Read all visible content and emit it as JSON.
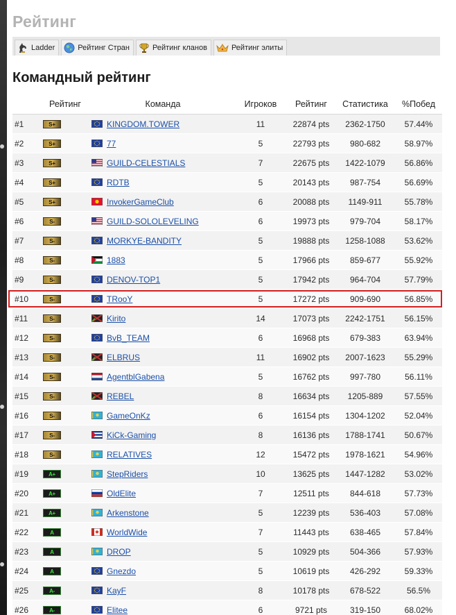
{
  "page": {
    "title": "Рейтинг"
  },
  "tabs": [
    {
      "label": "Ladder",
      "icon": "knight-icon"
    },
    {
      "label": "Рейтинг Стран",
      "icon": "globe-icon"
    },
    {
      "label": "Рейтинг кланов",
      "icon": "trophy-icon"
    },
    {
      "label": "Рейтинг элиты",
      "icon": "crown-icon"
    }
  ],
  "section": {
    "title": "Командный рейтинг"
  },
  "table": {
    "headers": {
      "rating": "Рейтинг",
      "team": "Команда",
      "players": "Игроков",
      "points": "Рейтинг",
      "stats": "Статистика",
      "winrate": "%Побед"
    },
    "highlight_rank": "#10",
    "rows": [
      {
        "rank": "#1",
        "tier": "S+",
        "flag": "eu",
        "team": "KINGDOM.TOWER",
        "players": "11",
        "points": "22874 pts",
        "stats": "2362-1750",
        "winrate": "57.44%"
      },
      {
        "rank": "#2",
        "tier": "S+",
        "flag": "eu",
        "team": "77",
        "players": "5",
        "points": "22793 pts",
        "stats": "980-682",
        "winrate": "58.97%"
      },
      {
        "rank": "#3",
        "tier": "S+",
        "flag": "us",
        "team": "GUILD-CELESTIALS",
        "players": "7",
        "points": "22675 pts",
        "stats": "1422-1079",
        "winrate": "56.86%"
      },
      {
        "rank": "#4",
        "tier": "S+",
        "flag": "eu",
        "team": "RDTB",
        "players": "5",
        "points": "20143 pts",
        "stats": "987-754",
        "winrate": "56.69%"
      },
      {
        "rank": "#5",
        "tier": "S+",
        "flag": "kg",
        "team": "InvokerGameClub",
        "players": "6",
        "points": "20088 pts",
        "stats": "1149-911",
        "winrate": "55.78%"
      },
      {
        "rank": "#6",
        "tier": "S-",
        "flag": "us",
        "team": "GUILD-SOLOLEVELING",
        "players": "6",
        "points": "19973 pts",
        "stats": "979-704",
        "winrate": "58.17%"
      },
      {
        "rank": "#7",
        "tier": "S-",
        "flag": "eu",
        "team": "MORKYE-BANDITY",
        "players": "5",
        "points": "19888 pts",
        "stats": "1258-1088",
        "winrate": "53.62%"
      },
      {
        "rank": "#8",
        "tier": "S-",
        "flag": "jo",
        "team": "1883",
        "players": "5",
        "points": "17966 pts",
        "stats": "859-677",
        "winrate": "55.92%"
      },
      {
        "rank": "#9",
        "tier": "S-",
        "flag": "eu",
        "team": "DENOV-TOP1",
        "players": "5",
        "points": "17942 pts",
        "stats": "964-704",
        "winrate": "57.79%"
      },
      {
        "rank": "#10",
        "tier": "S-",
        "flag": "eu",
        "team": "TRooY",
        "players": "5",
        "points": "17272 pts",
        "stats": "909-690",
        "winrate": "56.85%"
      },
      {
        "rank": "#11",
        "tier": "S-",
        "flag": "xx",
        "team": "Kirito",
        "players": "14",
        "points": "17073 pts",
        "stats": "2242-1751",
        "winrate": "56.15%"
      },
      {
        "rank": "#12",
        "tier": "S-",
        "flag": "eu",
        "team": "BvB_TEAM",
        "players": "6",
        "points": "16968 pts",
        "stats": "679-383",
        "winrate": "63.94%"
      },
      {
        "rank": "#13",
        "tier": "S-",
        "flag": "xx",
        "team": "ELBRUS",
        "players": "11",
        "points": "16902 pts",
        "stats": "2007-1623",
        "winrate": "55.29%"
      },
      {
        "rank": "#14",
        "tier": "S-",
        "flag": "nl",
        "team": "AgentblGabena",
        "players": "5",
        "points": "16762 pts",
        "stats": "997-780",
        "winrate": "56.11%"
      },
      {
        "rank": "#15",
        "tier": "S-",
        "flag": "xx",
        "team": "REBEL",
        "players": "8",
        "points": "16634 pts",
        "stats": "1205-889",
        "winrate": "57.55%"
      },
      {
        "rank": "#16",
        "tier": "S-",
        "flag": "kz",
        "team": "GameOnKz",
        "players": "6",
        "points": "16154 pts",
        "stats": "1304-1202",
        "winrate": "52.04%"
      },
      {
        "rank": "#17",
        "tier": "S-",
        "flag": "cu",
        "team": "KiCk-Gaming",
        "players": "8",
        "points": "16136 pts",
        "stats": "1788-1741",
        "winrate": "50.67%"
      },
      {
        "rank": "#18",
        "tier": "S-",
        "flag": "kz",
        "team": "RELATIVES",
        "players": "12",
        "points": "15472 pts",
        "stats": "1978-1621",
        "winrate": "54.96%"
      },
      {
        "rank": "#19",
        "tier": "A+",
        "flag": "kz",
        "team": "StepRiders",
        "players": "10",
        "points": "13625 pts",
        "stats": "1447-1282",
        "winrate": "53.02%"
      },
      {
        "rank": "#20",
        "tier": "A+",
        "flag": "ru",
        "team": "OldElite",
        "players": "7",
        "points": "12511 pts",
        "stats": "844-618",
        "winrate": "57.73%"
      },
      {
        "rank": "#21",
        "tier": "A+",
        "flag": "kz",
        "team": "Arkenstone",
        "players": "5",
        "points": "12239 pts",
        "stats": "536-403",
        "winrate": "57.08%"
      },
      {
        "rank": "#22",
        "tier": "A",
        "flag": "ca",
        "team": "WorldWide",
        "players": "7",
        "points": "11443 pts",
        "stats": "638-465",
        "winrate": "57.84%"
      },
      {
        "rank": "#23",
        "tier": "A",
        "flag": "kz",
        "team": "DROP",
        "players": "5",
        "points": "10929 pts",
        "stats": "504-366",
        "winrate": "57.93%"
      },
      {
        "rank": "#24",
        "tier": "A",
        "flag": "eu",
        "team": "Gnezdo",
        "players": "5",
        "points": "10619 pts",
        "stats": "426-292",
        "winrate": "59.33%"
      },
      {
        "rank": "#25",
        "tier": "A-",
        "flag": "eu",
        "team": "KayF",
        "players": "8",
        "points": "10178 pts",
        "stats": "678-522",
        "winrate": "56.5%"
      },
      {
        "rank": "#26",
        "tier": "A-",
        "flag": "eu",
        "team": "Elitee",
        "players": "6",
        "points": "9721 pts",
        "stats": "319-150",
        "winrate": "68.02%"
      }
    ]
  }
}
